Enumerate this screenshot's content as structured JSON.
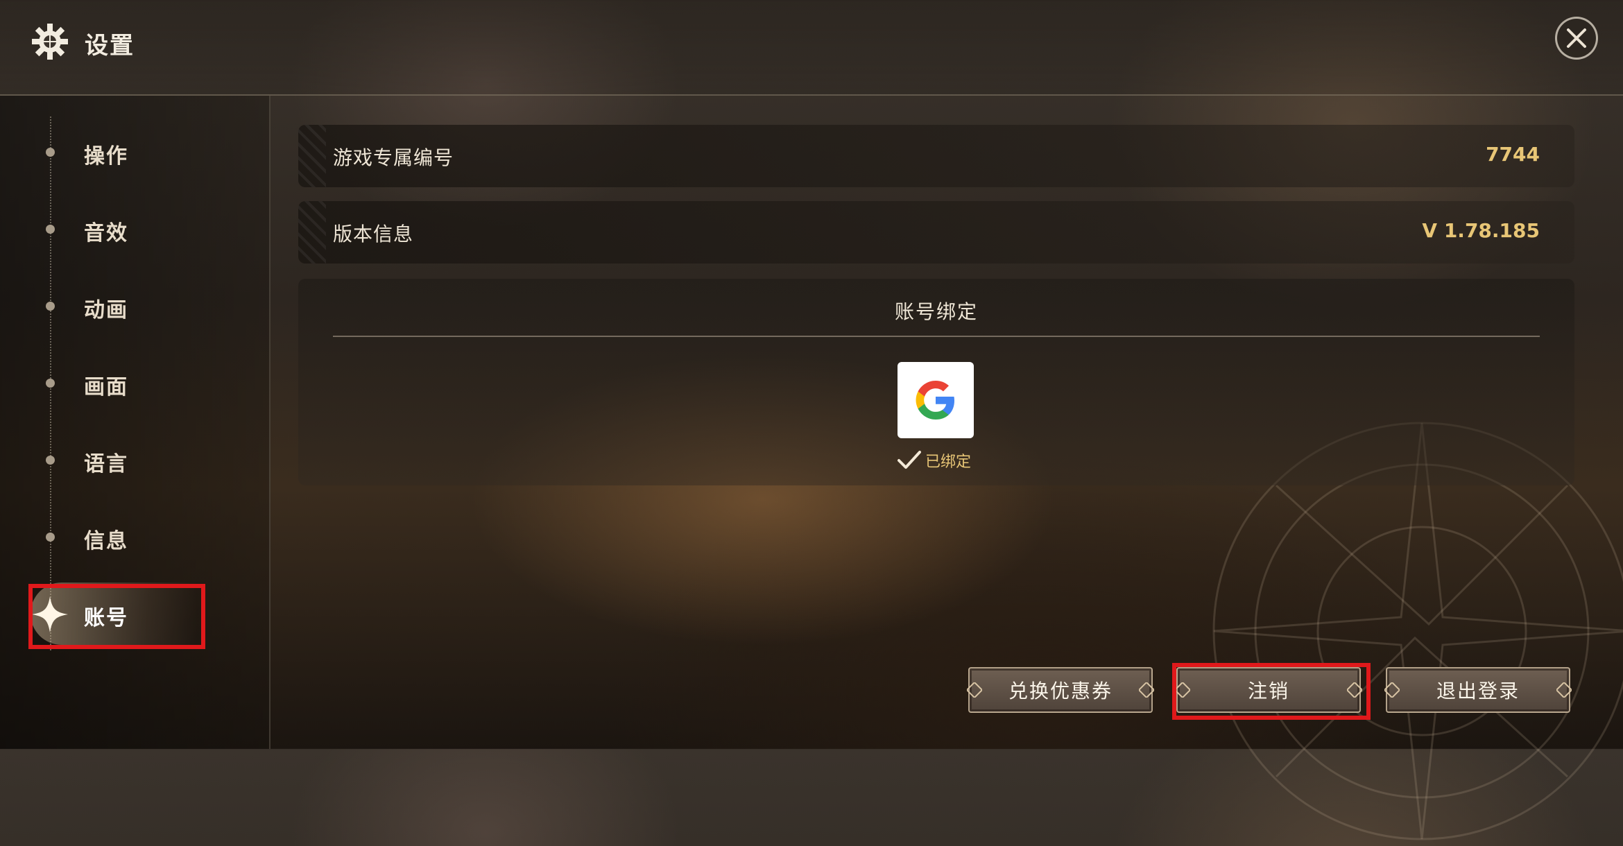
{
  "header": {
    "title": "设置",
    "icon": "gear-icon",
    "close_icon": "close-icon"
  },
  "sidebar": {
    "items": [
      {
        "label": "操作"
      },
      {
        "label": "音效"
      },
      {
        "label": "动画"
      },
      {
        "label": "画面"
      },
      {
        "label": "语言"
      },
      {
        "label": "信息"
      },
      {
        "label": "账号",
        "active": true
      }
    ]
  },
  "info": {
    "game_id": {
      "label": "游戏专属编号",
      "value": "7744"
    },
    "version": {
      "label": "版本信息",
      "value": "V 1.78.185"
    }
  },
  "binding": {
    "title": "账号绑定",
    "provider_icon": "google-icon",
    "status": "已绑定"
  },
  "buttons": {
    "redeem": "兑换优惠券",
    "deregister": "注销",
    "logout": "退出登录"
  },
  "colors": {
    "accent_gold": "#e8c676",
    "highlight_red": "#e0191b"
  }
}
